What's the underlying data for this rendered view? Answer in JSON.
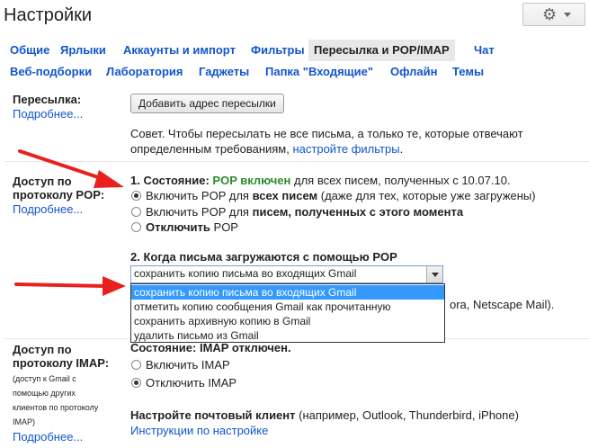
{
  "header": {
    "title": "Настройки",
    "settings_icon": "gear-icon"
  },
  "tabs_row1": [
    "Общие",
    "Ярлыки",
    "Аккаунты и импорт",
    "Фильтры",
    "Пересылка и POP/IMAP",
    "Чат"
  ],
  "tabs_row2": [
    "Веб-подборки",
    "Лаборатория",
    "Гаджеты",
    "Папка \"Входящие\"",
    "Офлайн",
    "Темы"
  ],
  "forwarding": {
    "label": "Пересылка:",
    "more": "Подробнее...",
    "button": "Добавить адрес пересылки",
    "tip_line1": "Совет. Чтобы пересылать не все письма, а только те, которые отвечают",
    "tip_line2_prefix": "определенным требованиям, ",
    "tip_link": "настройте фильтры",
    "tip_suffix": "."
  },
  "pop": {
    "label_line1": "Доступ по",
    "label_line2": "протоколу POP:",
    "more": "Подробнее...",
    "status_prefix": "1. Состояние: ",
    "status_value": "POP включен",
    "status_suffix": " для всех писем, полученных с 10.07.10.",
    "option1_prefix": "Включить POP для ",
    "option1_bold": "всех писем",
    "option1_suffix": " (даже для тех, которые уже загружены)",
    "option2_prefix": "Включить POP для ",
    "option2_bold": "писем, полученных с этого момента",
    "option3_bold": "Отключить",
    "option3_suffix": " POP",
    "when_title": "2. Когда письма загружаются с помощью POP",
    "select_value": "сохранить копию письма во входящих Gmail",
    "options": [
      "сохранить копию письма во входящих Gmail",
      "отметить копию сообщения Gmail как прочитанную",
      "сохранить архивную копию в Gmail",
      "удалить письмо из Gmail"
    ],
    "hidden_tail": "ora, Netscape Mail)."
  },
  "imap": {
    "label_line1": "Доступ по",
    "label_line2": "протоколу IMAP:",
    "note_lines": [
      "(доступ к Gmail с",
      "помощью других",
      "клиентов по протоколу",
      "IMAP)"
    ],
    "more": "Подробнее...",
    "status_prefix": "Состояние: ",
    "status_value": "IMAP отключен.",
    "option1": "Включить IMAP",
    "option2": "Отключить IMAP",
    "client_bold": "Настройте почтовый клиент",
    "client_suffix": " (например, Outlook, Thunderbird, iPhone)",
    "client_link": "Инструкции по настройке"
  },
  "colors": {
    "link": "#1155cc",
    "accent_green": "#2a8c2a",
    "arrow": "#e8201e",
    "selection": "#3399ff"
  }
}
